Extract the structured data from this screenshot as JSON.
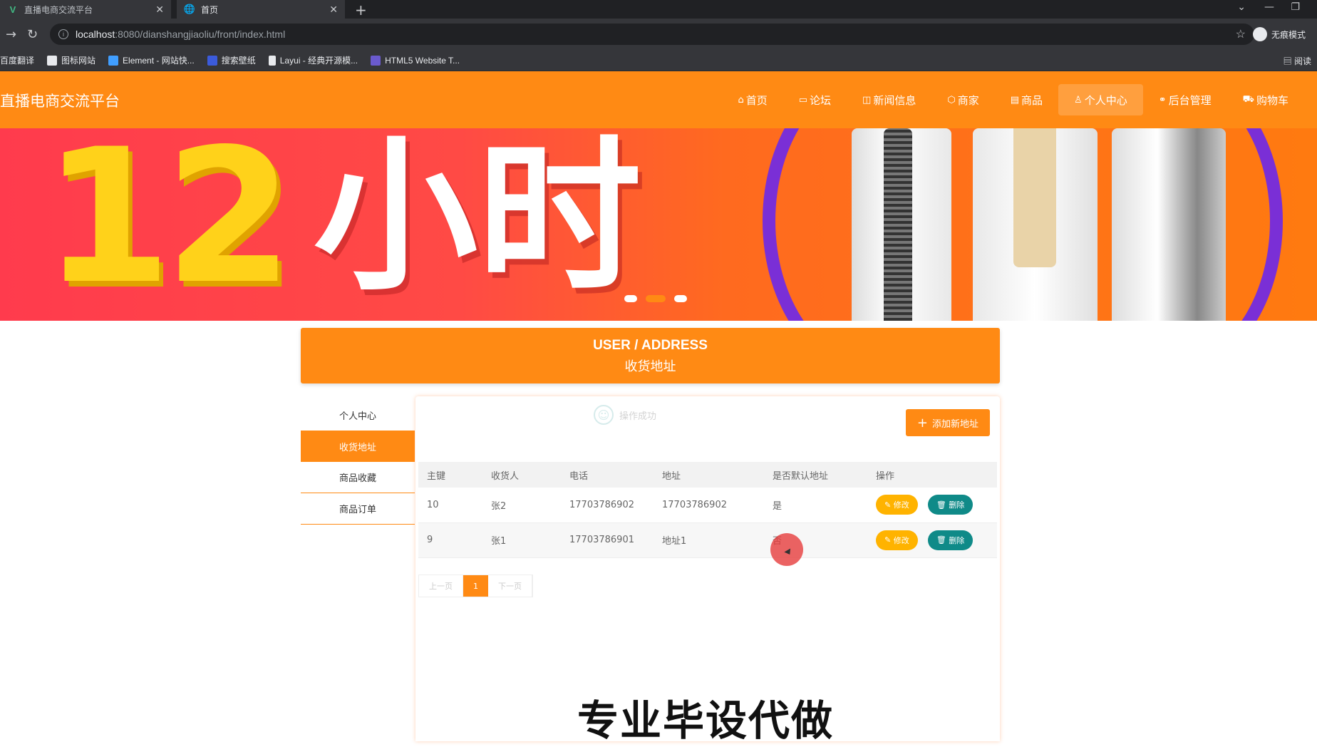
{
  "browser": {
    "tabs": [
      {
        "title": "直播电商交流平台",
        "icon": "vue-logo-icon"
      },
      {
        "title": "首页",
        "icon": "globe-icon"
      }
    ],
    "url_host": "localhost",
    "url_path": ":8080/dianshangjiaoliu/front/index.html",
    "profile_label": "无痕模式",
    "bookmarks": [
      {
        "label": "百度翻译"
      },
      {
        "label": "图标网站"
      },
      {
        "label": "Element - 网站快..."
      },
      {
        "label": "搜索壁纸"
      },
      {
        "label": "Layui - 经典开源模..."
      },
      {
        "label": "HTML5 Website T..."
      }
    ],
    "reader_label": "阅读"
  },
  "site": {
    "logo": "直播电商交流平台",
    "menu": [
      {
        "label": "首页",
        "icon": "home-icon"
      },
      {
        "label": "论坛",
        "icon": "chat-icon"
      },
      {
        "label": "新闻信息",
        "icon": "news-icon"
      },
      {
        "label": "商家",
        "icon": "shop-icon"
      },
      {
        "label": "商品",
        "icon": "goods-icon"
      },
      {
        "label": "个人中心",
        "icon": "user-icon"
      },
      {
        "label": "后台管理",
        "icon": "link-icon"
      },
      {
        "label": "购物车",
        "icon": "cart-icon"
      }
    ],
    "active_menu": "个人中心"
  },
  "banner": {
    "number": "12",
    "text": "小时",
    "active_slide": 2,
    "slides": 3
  },
  "section": {
    "title_en": "USER / ADDRESS",
    "title_cn": "收货地址"
  },
  "sidebar": {
    "items": [
      {
        "label": "个人中心"
      },
      {
        "label": "收货地址"
      },
      {
        "label": "商品收藏"
      },
      {
        "label": "商品订单"
      }
    ],
    "active": "收货地址"
  },
  "panel": {
    "toast": "操作成功",
    "add_button": "添加新地址",
    "columns": [
      "主键",
      "收货人",
      "电话",
      "地址",
      "是否默认地址",
      "操作"
    ],
    "rows": [
      {
        "id": "10",
        "name": "张2",
        "phone": "17703786902",
        "address": "17703786902",
        "default": "是"
      },
      {
        "id": "9",
        "name": "张1",
        "phone": "17703786901",
        "address": "地址1",
        "default": "否"
      }
    ],
    "edit_label": "修改",
    "delete_label": "删除",
    "pager": {
      "prev": "上一页",
      "current": "1",
      "next": "下一页"
    }
  },
  "watermark": "专业毕设代做",
  "colors": {
    "accent": "#ff8a14",
    "delete": "#0f8a88",
    "edit": "#ffb300"
  }
}
